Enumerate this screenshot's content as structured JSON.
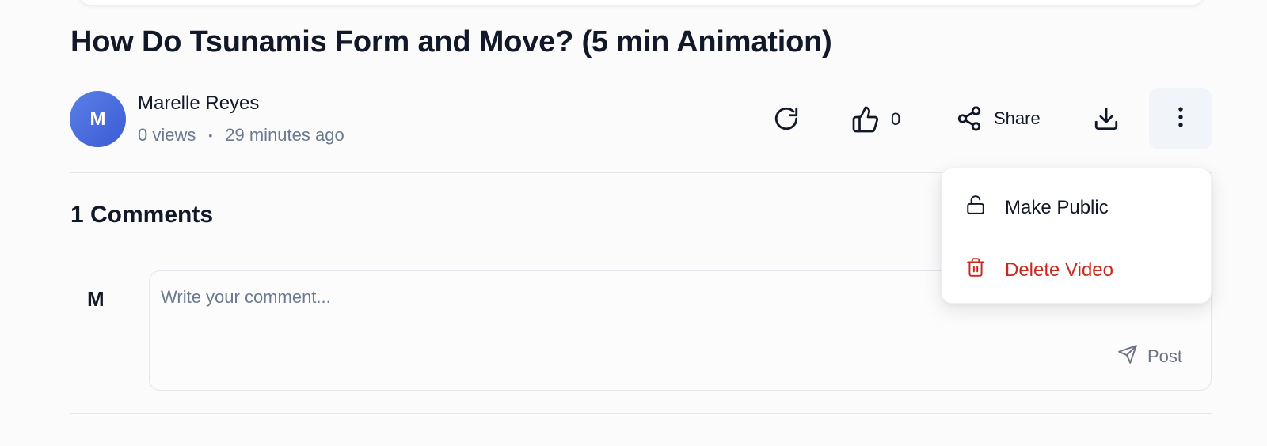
{
  "video": {
    "title": "How Do Tsunamis Form and Move? (5 min Animation)"
  },
  "channel": {
    "avatar_initial": "M",
    "name": "Marelle Reyes",
    "views": "0 views",
    "separator": "•",
    "posted": "29 minutes ago"
  },
  "actions": {
    "refresh_icon": "refresh-icon",
    "like_icon": "thumbs-up-icon",
    "like_count": "0",
    "share_icon": "share-icon",
    "share_label": "Share",
    "download_icon": "download-icon",
    "more_icon": "more-vertical-icon"
  },
  "menu": {
    "items": [
      {
        "label": "Make Public",
        "icon": "unlock-icon",
        "color": "#111827"
      },
      {
        "label": "Delete Video",
        "icon": "trash-icon",
        "color": "#c8281e"
      }
    ]
  },
  "comments": {
    "heading": "1 Comments",
    "commenter_initial": "M",
    "placeholder": "Write your comment...",
    "post_label": "Post",
    "post_icon": "send-icon"
  },
  "colors": {
    "accent_avatar": "#4a6ae0",
    "danger": "#c8281e",
    "muted_text": "#6b7a90"
  }
}
